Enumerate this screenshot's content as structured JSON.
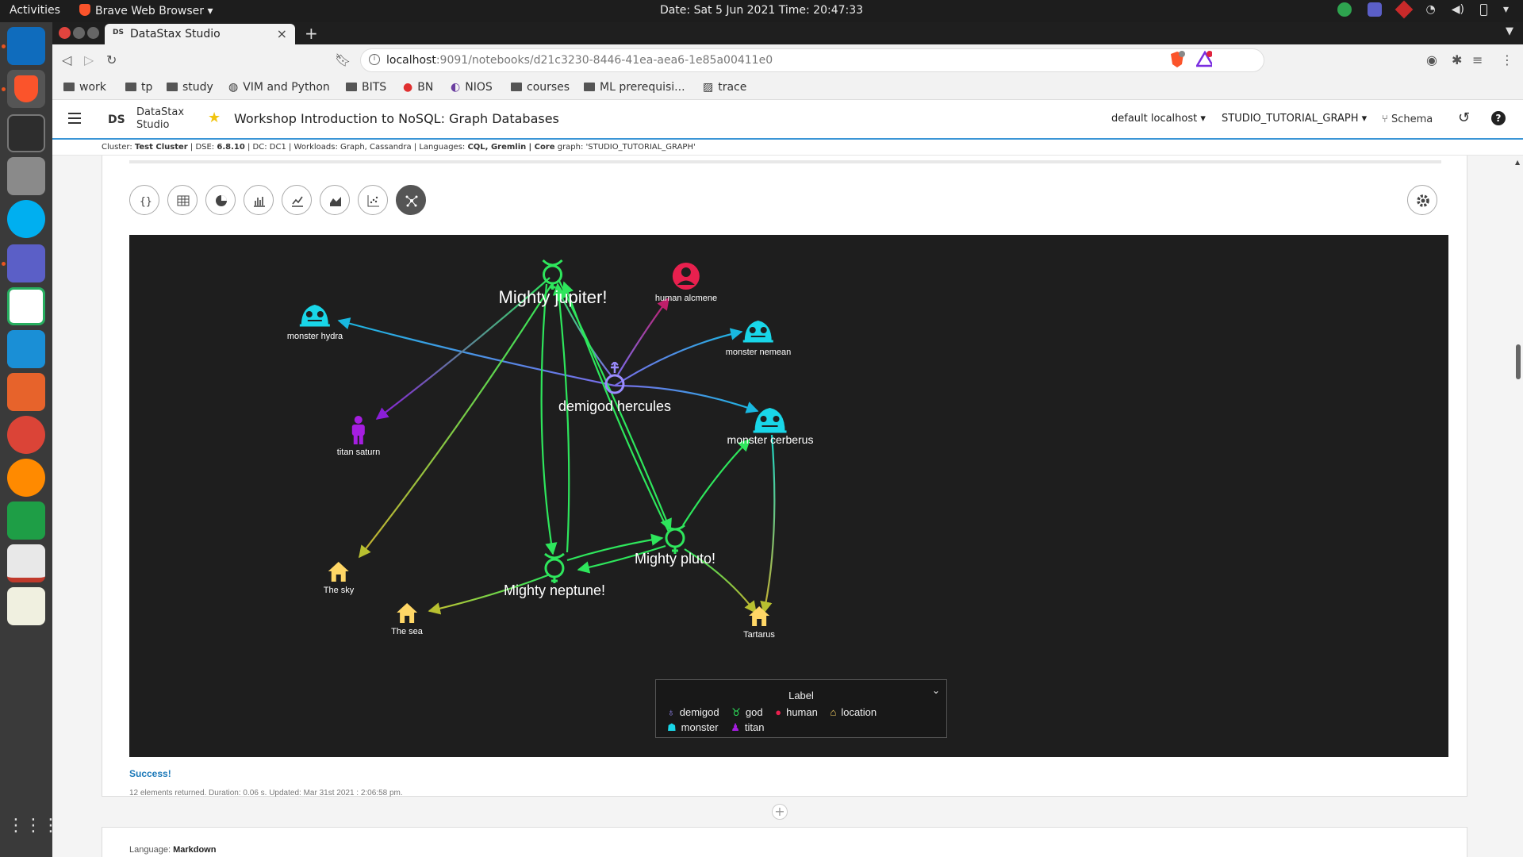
{
  "topbar": {
    "activities": "Activities",
    "app_name": "Brave Web Browser",
    "clock": "Date: Sat  5 Jun 2021  Time: 20:47:33"
  },
  "browser": {
    "tab_title": "DataStax Studio",
    "tab_favicon": "DS",
    "url_host": "localhost",
    "url_path": ":9091/notebooks/d21c3230-8446-41ea-aea6-1e85a00411e0",
    "shield_count": "1",
    "bookmarks": [
      "work",
      "tp",
      "study",
      "VIM and Python",
      "BITS",
      "BN",
      "NIOS",
      "courses",
      "ML prerequisi...",
      "trace"
    ]
  },
  "studio": {
    "logo": "DS",
    "brand_line1": "DataStax",
    "brand_line2": "Studio",
    "notebook_title": "Workshop Introduction to NoSQL: Graph Databases",
    "connection": "default localhost",
    "graph_name": "STUDIO_TUTORIAL_GRAPH",
    "schema_label": "Schema",
    "cluster_info": {
      "cluster_label": "Cluster:",
      "cluster": "Test Cluster",
      "dse_label": "| DSE:",
      "dse": "6.8.10",
      "dc": "| DC: DC1 | Workloads: Graph, Cassandra | Languages:",
      "languages": "CQL, Gremlin",
      "core_label": "| Core",
      "core": "graph: 'STUDIO_TUTORIAL_GRAPH'"
    }
  },
  "result": {
    "status": "Success!",
    "meta": "12 elements returned. Duration: 0.06 s. Updated: Mar 31st 2021 : 2:06:58 pm."
  },
  "next_cell": {
    "language_label": "Language:",
    "language": "Markdown"
  },
  "graph": {
    "nodes": [
      {
        "id": "jupiter",
        "label": "Mighty jupiter!",
        "type": "god"
      },
      {
        "id": "alcmene",
        "label": "human alcmene",
        "type": "human"
      },
      {
        "id": "hydra",
        "label": "monster hydra",
        "type": "monster"
      },
      {
        "id": "nemean",
        "label": "monster nemean",
        "type": "monster"
      },
      {
        "id": "hercules",
        "label": "demigod hercules",
        "type": "demigod"
      },
      {
        "id": "saturn",
        "label": "titan saturn",
        "type": "titan"
      },
      {
        "id": "cerberus",
        "label": "monster cerberus",
        "type": "monster"
      },
      {
        "id": "sky",
        "label": "The sky",
        "type": "location"
      },
      {
        "id": "pluto",
        "label": "Mighty pluto!",
        "type": "god"
      },
      {
        "id": "neptune",
        "label": "Mighty neptune!",
        "type": "god"
      },
      {
        "id": "sea",
        "label": "The sea",
        "type": "location"
      },
      {
        "id": "tartarus",
        "label": "Tartarus",
        "type": "location"
      }
    ],
    "legend": {
      "title": "Label",
      "items": [
        {
          "label": "demigod",
          "color": "#9b8cff"
        },
        {
          "label": "god",
          "color": "#2ee65c"
        },
        {
          "label": "human",
          "color": "#e8204e"
        },
        {
          "label": "location",
          "color": "#ffd766"
        },
        {
          "label": "monster",
          "color": "#19d6e8"
        },
        {
          "label": "titan",
          "color": "#a51ee0"
        }
      ]
    }
  }
}
